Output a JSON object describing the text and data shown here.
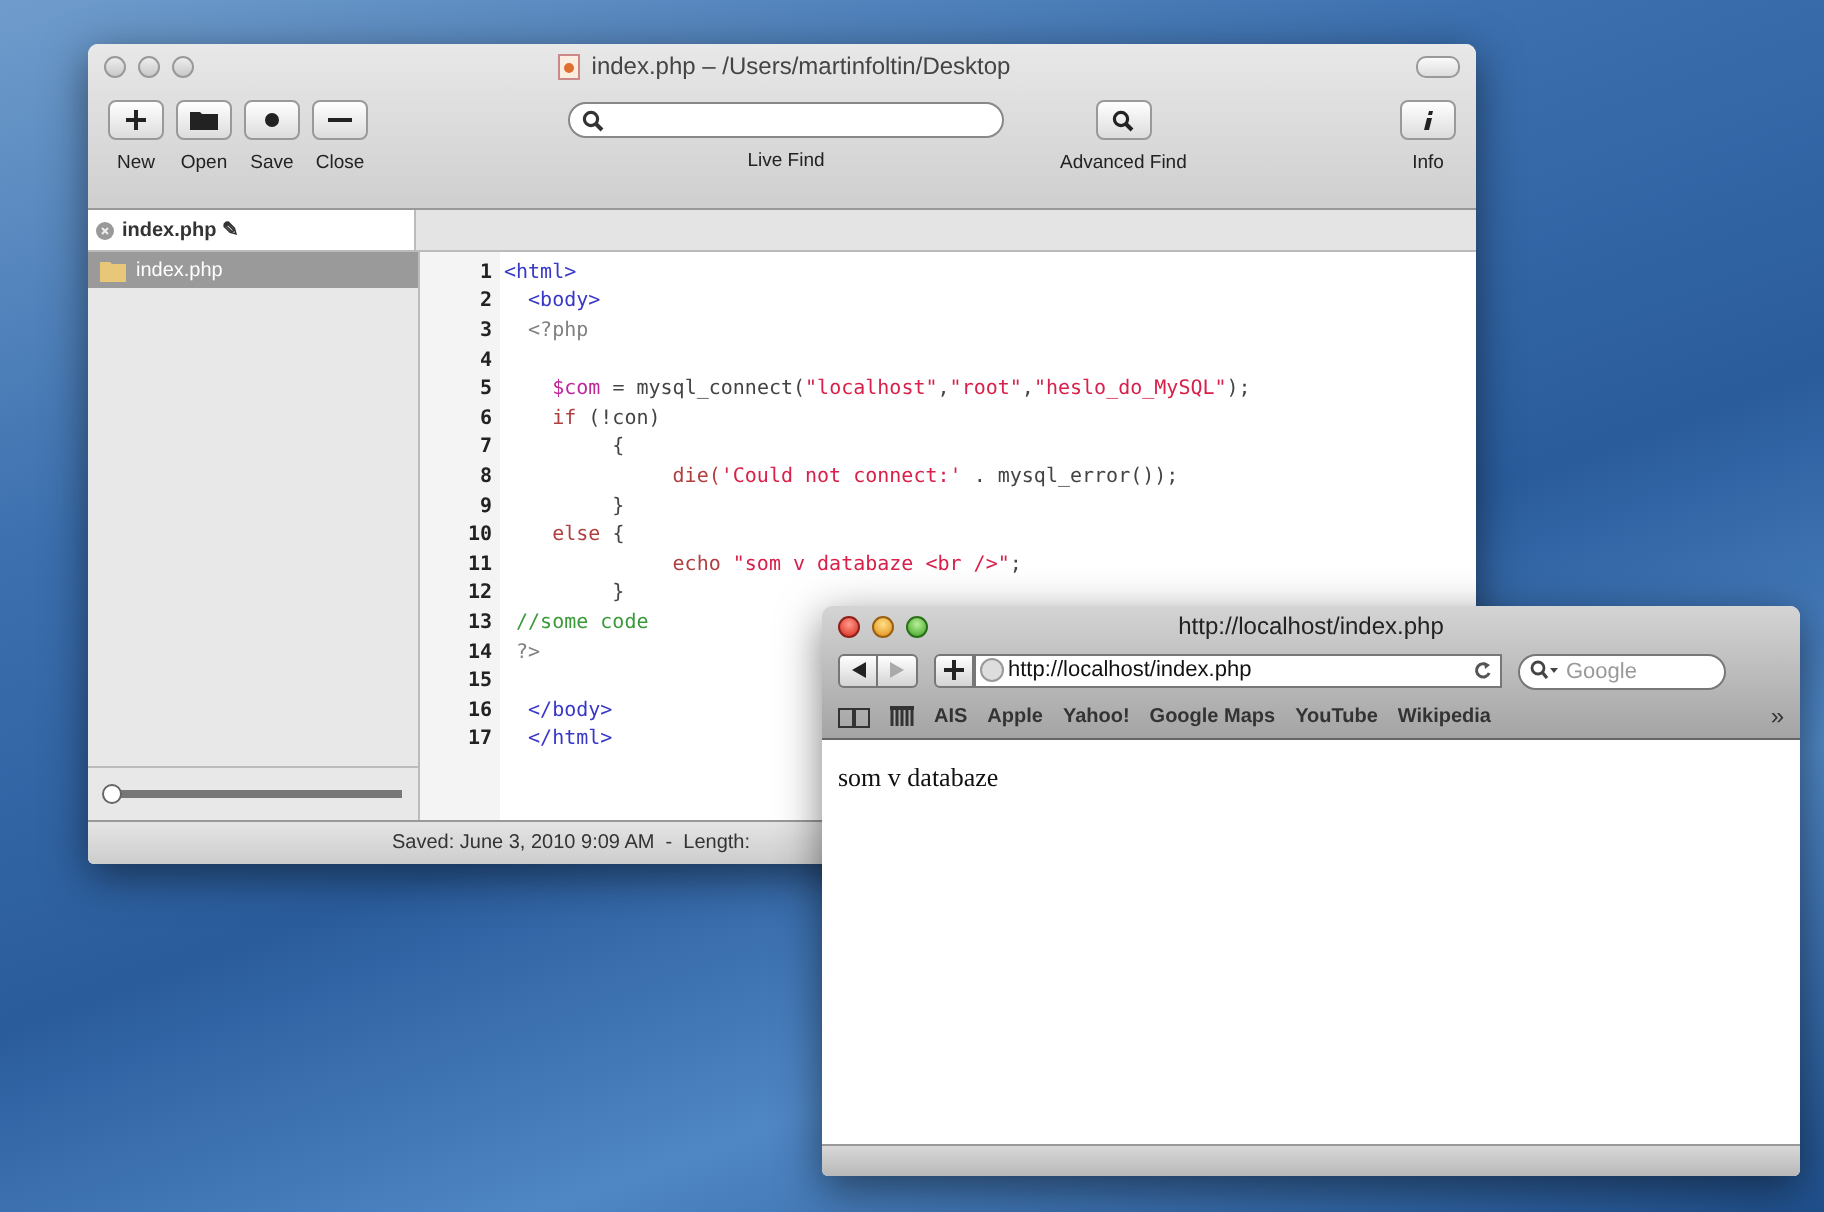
{
  "editor": {
    "title": "index.php – /Users/martinfoltin/Desktop",
    "active": false,
    "tools": [
      {
        "kind": "new",
        "label": "New"
      },
      {
        "kind": "open",
        "label": "Open"
      },
      {
        "kind": "save",
        "label": "Save"
      },
      {
        "kind": "close",
        "label": "Close"
      }
    ],
    "live_find": "Live Find",
    "advanced_find": "Advanced Find",
    "info": "Info",
    "tab": {
      "label": "index.php ✎"
    },
    "sidebar": {
      "items": [
        {
          "label": "index.php",
          "selected": true
        }
      ]
    },
    "slider": {
      "level": 0.03
    },
    "code": [
      {
        "number": "1",
        "segments": [
          {
            "kind": "tag",
            "text": "<html>"
          }
        ]
      },
      {
        "number": "2",
        "segments": [
          {
            "kind": "tag",
            "text": "  <body>"
          }
        ]
      },
      {
        "number": "3",
        "segments": [
          {
            "kind": "php",
            "text": "  <?php"
          }
        ]
      },
      {
        "number": "4"
      },
      {
        "number": "5",
        "segments": [
          {
            "kind": "var",
            "text": "    $com"
          },
          {
            "kind": "plain",
            "text": " = mysql_connect("
          },
          {
            "kind": "string",
            "text": "\"localhost\""
          },
          {
            "kind": "plain",
            "text": ","
          },
          {
            "kind": "string",
            "text": "\"root\""
          },
          {
            "kind": "plain",
            "text": ","
          },
          {
            "kind": "string",
            "text": "\"heslo_do_MySQL\""
          },
          {
            "kind": "plain",
            "text": ");"
          }
        ]
      },
      {
        "number": "6",
        "segments": [
          {
            "kind": "keyword",
            "text": "    if"
          },
          {
            "kind": "plain",
            "text": " (!con)"
          }
        ]
      },
      {
        "number": "7",
        "segments": [
          {
            "kind": "plain",
            "text": "         {"
          }
        ]
      },
      {
        "number": "8",
        "segments": [
          {
            "kind": "keyword",
            "text": "              die("
          },
          {
            "kind": "string",
            "text": "'Could not connect:'"
          },
          {
            "kind": "plain",
            "text": " . mysql_error());"
          }
        ]
      },
      {
        "number": "9",
        "segments": [
          {
            "kind": "plain",
            "text": "         }"
          }
        ]
      },
      {
        "number": "10",
        "segments": [
          {
            "kind": "keyword",
            "text": "    else"
          },
          {
            "kind": "plain",
            "text": " {"
          }
        ]
      },
      {
        "number": "11",
        "segments": [
          {
            "kind": "keyword",
            "text": "              echo "
          },
          {
            "kind": "string",
            "text": "\"som v databaze <br />\""
          },
          {
            "kind": "plain",
            "text": ";"
          }
        ]
      },
      {
        "number": "12",
        "segments": [
          {
            "kind": "plain",
            "text": "         }"
          }
        ]
      },
      {
        "number": "13",
        "segments": [
          {
            "kind": "comment",
            "text": " //some code"
          }
        ]
      },
      {
        "number": "14",
        "segments": [
          {
            "kind": "php",
            "text": " ?>"
          }
        ]
      },
      {
        "number": "15"
      },
      {
        "number": "16",
        "segments": [
          {
            "kind": "tag",
            "text": "  </body>"
          }
        ]
      },
      {
        "number": "17",
        "segments": [
          {
            "kind": "tag",
            "text": "  </html>"
          }
        ]
      }
    ],
    "status": "Saved: June 3, 2010 9:09 AM  -  Length:"
  },
  "browser": {
    "title": "http://localhost/index.php",
    "active": true,
    "url": "http://localhost/index.php",
    "search": {
      "placeholder": "Google"
    },
    "bookmarks": [
      "AIS",
      "Apple",
      "Yahoo!",
      "Google Maps",
      "YouTube",
      "Wikipedia"
    ],
    "more": "»",
    "content": "som v databaze"
  }
}
